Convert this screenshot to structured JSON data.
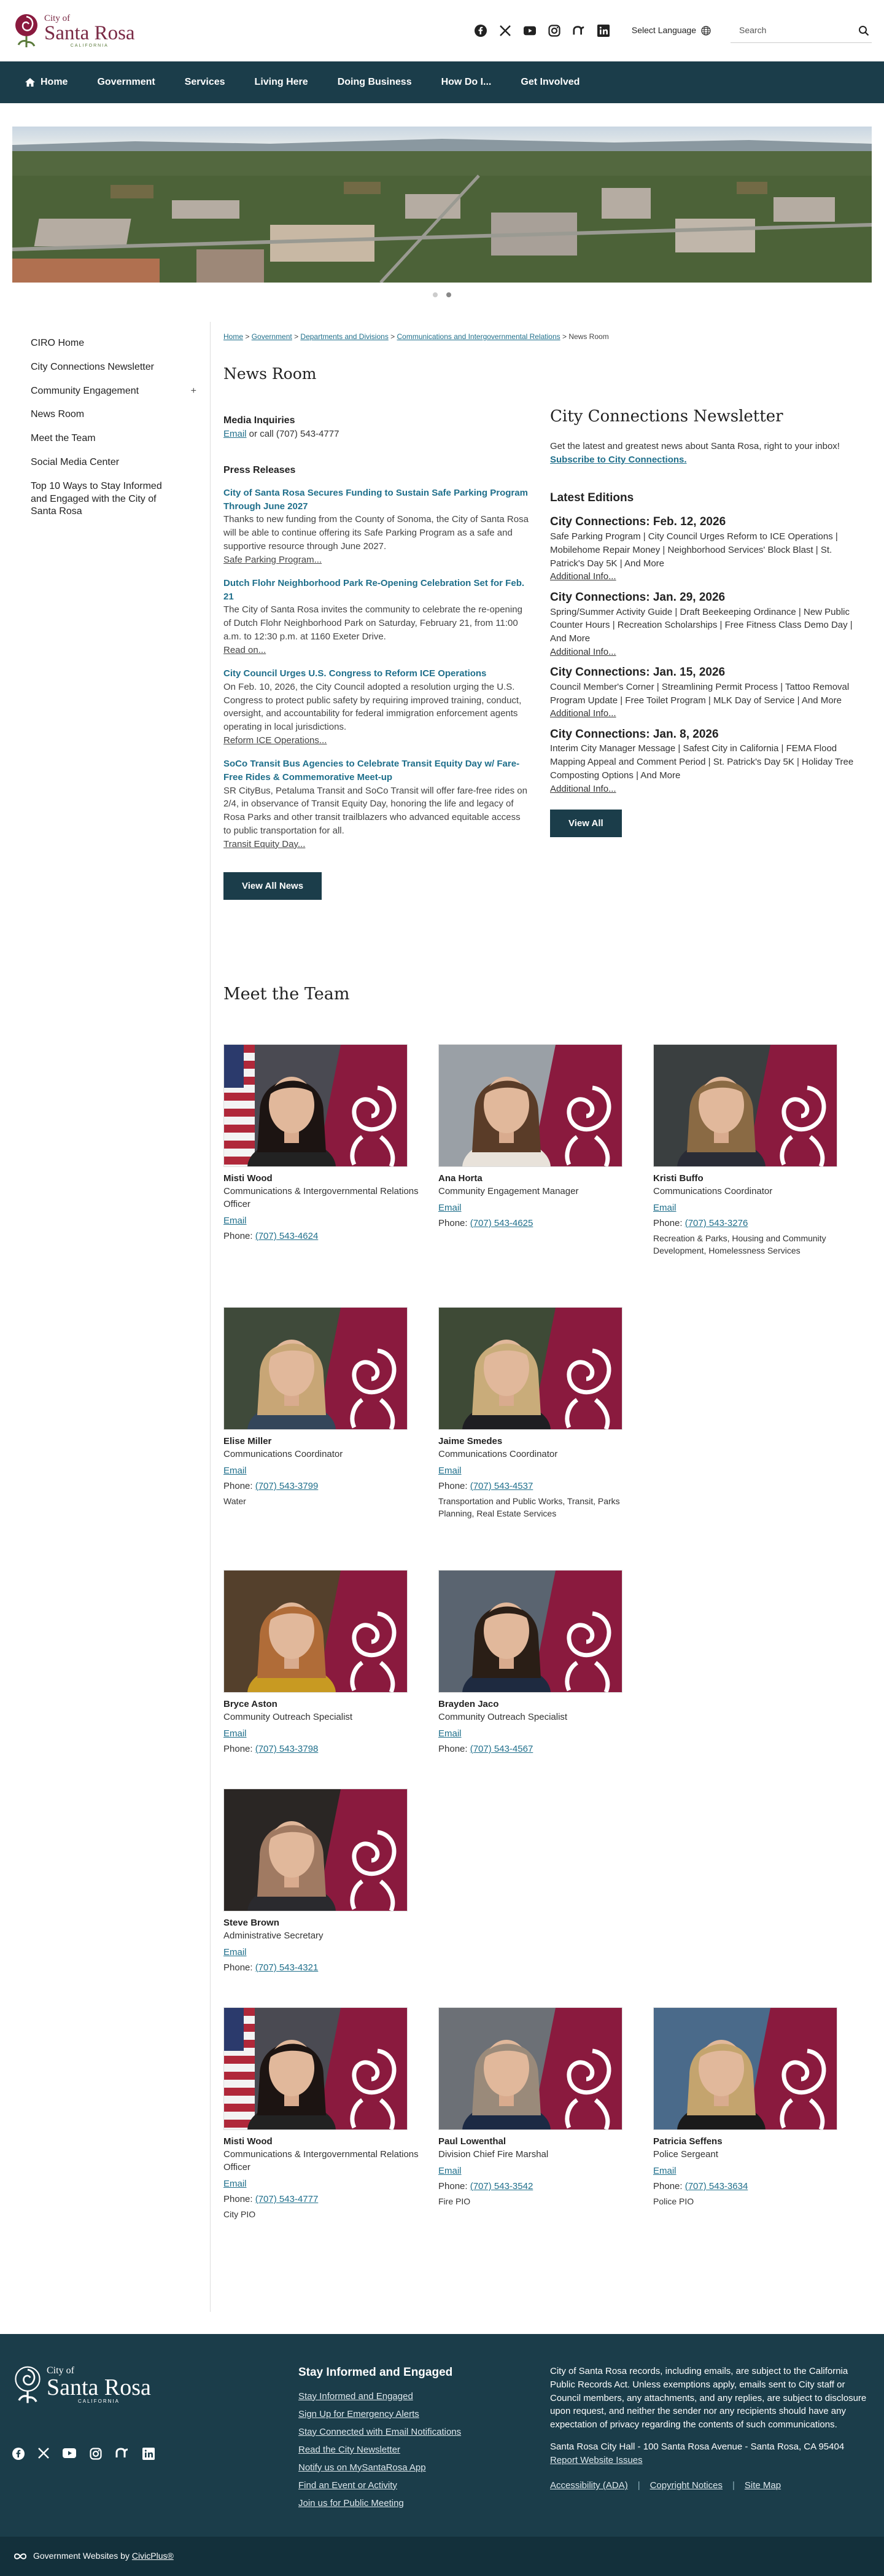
{
  "header": {
    "logo": {
      "line1": "City of",
      "line2": "Santa Rosa",
      "line3": "CALIFORNIA"
    },
    "language_label": "Select Language",
    "search_placeholder": "Search"
  },
  "nav": {
    "home": "Home",
    "items": [
      "Government",
      "Services",
      "Living Here",
      "Doing Business",
      "How Do I...",
      "Get Involved"
    ]
  },
  "sidebar": [
    {
      "label": "CIRO Home"
    },
    {
      "label": "City Connections Newsletter"
    },
    {
      "label": "Community Engagement",
      "expand": "+"
    },
    {
      "label": "News Room"
    },
    {
      "label": "Meet the Team"
    },
    {
      "label": "Social Media Center"
    },
    {
      "label": "Top 10 Ways to Stay Informed and Engaged with the City of Santa Rosa"
    }
  ],
  "breadcrumb": [
    "Home",
    "Government",
    "Departments and Divisions",
    "Communications and Intergovernmental Relations",
    "News Room"
  ],
  "page_title": "News Room",
  "media": {
    "heading": "Media Inquiries",
    "email_link": "Email",
    "text": " or call (707) 543-4777"
  },
  "press": {
    "heading": "Press Releases",
    "items": [
      {
        "title": "City of Santa Rosa Secures Funding to Sustain Safe Parking Program Through June 2027",
        "body": "Thanks to new funding from the County of Sonoma, the City of Santa Rosa will be able to continue offering its Safe Parking Program as a safe and supportive resource through June 2027.",
        "link": "Safe Parking Program..."
      },
      {
        "title": "Dutch Flohr Neighborhood Park Re-Opening Celebration Set for Feb. 21",
        "body": "The City of Santa Rosa invites the community to celebrate the re-opening of Dutch Flohr Neighborhood Park on Saturday, February 21, from 11:00 a.m. to 12:30 p.m. at 1160 Exeter Drive.",
        "link": "Read on..."
      },
      {
        "title": "City Council Urges U.S. Congress to Reform ICE Operations",
        "body": "On Feb. 10, 2026, the City Council adopted a resolution urging the U.S. Congress to protect public safety by requiring improved training, conduct, oversight, and accountability for federal immigration enforcement agents operating in local jurisdictions.",
        "link": "Reform ICE Operations..."
      },
      {
        "title": "SoCo Transit Bus Agencies to Celebrate Transit Equity Day w/ Fare-Free Rides & Commemorative Meet-up",
        "body": "SR CityBus, Petaluma Transit and SoCo Transit will offer fare-free rides on 2/4, in observance of Transit Equity Day, honoring the life and legacy of Rosa Parks and other transit trailblazers who advanced equitable access to public transportation for all.",
        "link": "Transit Equity Day..."
      }
    ],
    "button": "View All News"
  },
  "newsletter": {
    "heading": "City Connections Newsletter",
    "intro": "Get the latest and greatest news about Santa Rosa, right to your inbox! ",
    "subscribe": "Subscribe to City Connections.",
    "latest_heading": "Latest Editions",
    "editions": [
      {
        "title": "City Connections: Feb. 12, 2026",
        "body": "Safe Parking Program | City Council Urges Reform to ICE Operations | Mobilehome Repair Money | Neighborhood Services' Block Blast | St. Patrick's Day 5K | And More",
        "link": "Additional Info..."
      },
      {
        "title": "City Connections: Jan. 29, 2026",
        "body": "Spring/Summer Activity Guide | Draft Beekeeping Ordinance | New Public Counter Hours | Recreation Scholarships | Free Fitness Class Demo Day | And More",
        "link": "Additional Info..."
      },
      {
        "title": "City Connections: Jan. 15, 2026",
        "body": "Council Member's Corner | Streamlining Permit Process | Tattoo Removal Program Update | Free Toilet Program | MLK Day of Service | And More",
        "link": "Additional Info..."
      },
      {
        "title": "City Connections: Jan. 8, 2026",
        "body": "Interim City Manager Message | Safest City in California | FEMA Flood Mapping Appeal and Comment Period | St. Patrick's Day 5K | Holiday Tree Composting Options | And More",
        "link": "Additional Info..."
      }
    ],
    "button": "View All"
  },
  "team": {
    "heading": "Meet the Team",
    "members": [
      {
        "name": "Misti Wood",
        "role": "Communications & Intergovernmental Relations Officer",
        "email": "Email",
        "phone_label": "Phone: ",
        "phone": "(707) 543-4624",
        "extra": "",
        "flag": true,
        "bg": "#4a4a52",
        "hair": "#1c1412",
        "top": "#222"
      },
      {
        "name": "Ana Horta",
        "role": "Community Engagement Manager",
        "email": "Email",
        "phone_label": "Phone: ",
        "phone": "(707) 543-4625",
        "extra": "",
        "flag": false,
        "bg": "#9aa0a6",
        "hair": "#5a3c28",
        "top": "#e8e2da"
      },
      {
        "name": "Kristi Buffo",
        "role": "Communications Coordinator",
        "email": "Email",
        "phone_label": "Phone: ",
        "phone": "(707) 543-3276",
        "extra": "Recreation & Parks, Housing and Community Development, Homelessness Services",
        "flag": false,
        "bg": "#3a3f40",
        "hair": "#8a6a44",
        "top": "#2a2c36"
      },
      {
        "name": "Elise Miller",
        "role": "Communications Coordinator",
        "email": "Email",
        "phone_label": "Phone: ",
        "phone": "(707) 543-3799",
        "extra": "Water",
        "flag": false,
        "bg": "#3f4a3a",
        "hair": "#c8a676",
        "top": "#34465a"
      },
      {
        "name": "Jaime Smedes",
        "role": "Communications Coordinator",
        "email": "Email",
        "phone_label": "Phone: ",
        "phone": "(707) 543-4537",
        "extra": "Transportation and Public Works, Transit, Parks Planning, Real Estate Services",
        "flag": false,
        "bg": "#3e4a36",
        "hair": "#c9ac7a",
        "top": "#1e1e22"
      },
      {
        "name": "Bryce Aston",
        "role": "Community Outreach Specialist",
        "email": "Email",
        "phone_label": "Phone: ",
        "phone": "(707) 543-3798",
        "extra": "",
        "flag": false,
        "bg": "#54402c",
        "hair": "#b06c38",
        "top": "#c89a22"
      },
      {
        "name": "Brayden Jaco",
        "role": "Community Outreach Specialist",
        "email": "Email",
        "phone_label": "Phone: ",
        "phone": "(707) 543-4567",
        "extra": "",
        "flag": false,
        "bg": "#5a6470",
        "hair": "#2a1e16",
        "top": "#1e2a40"
      },
      {
        "name": "Steve Brown",
        "role": "Administrative Secretary",
        "email": "Email",
        "phone_label": "Phone: ",
        "phone": "(707) 543-4321",
        "extra": "",
        "flag": false,
        "bg": "#2a2624",
        "hair": "#a07a62",
        "top": "#2a2a2e"
      },
      {
        "name": "Misti Wood",
        "role": "Communications & Intergovernmental Relations Officer",
        "email": "Email",
        "phone_label": "Phone: ",
        "phone": "(707) 543-4777",
        "extra": "City PIO",
        "flag": true,
        "bg": "#4a4a52",
        "hair": "#1c1412",
        "top": "#222"
      },
      {
        "name": "Paul Lowenthal",
        "role": "Division Chief Fire Marshal",
        "email": "Email",
        "phone_label": "Phone: ",
        "phone": "(707) 543-3542",
        "extra": "Fire PIO",
        "flag": false,
        "bg": "#6c7076",
        "hair": "#9a8a7a",
        "top": "#1c2a44"
      },
      {
        "name": "Patricia Seffens",
        "role": "Police Sergeant",
        "email": "Email",
        "phone_label": "Phone: ",
        "phone": "(707) 543-3634",
        "extra": "Police PIO",
        "flag": false,
        "bg": "#4a6a8a",
        "hair": "#c4a46e",
        "top": "#1a1a1a"
      }
    ]
  },
  "footer": {
    "logo": {
      "line1": "City of",
      "line2": "Santa Rosa",
      "line3": "CALIFORNIA"
    },
    "heading": "Stay Informed and Engaged",
    "links": [
      "Stay Informed and Engaged",
      "Sign Up for Emergency Alerts",
      "Stay Connected with Email Notifications",
      "Read the City Newsletter",
      "Notify us on MySantaRosa App",
      "Find an Event or Activity",
      "Join us for Public Meeting"
    ],
    "notice": "City of Santa Rosa records, including emails, are subject to the California Public Records Act. Unless exemptions apply, emails sent to City staff or Council members, any attachments, and any replies, are subject to disclosure upon request, and neither the sender nor any recipients should have any expectation of privacy regarding the contents of such communications.",
    "address": "Santa Rosa City Hall - 100 Santa Rosa Avenue - Santa Rosa, CA 95404",
    "report": "Report Website Issues",
    "legal": [
      "Accessibility (ADA)",
      "Copyright Notices",
      "Site Map"
    ],
    "powered_prefix": "Government Websites by ",
    "powered_link": "CivicPlus®"
  },
  "colors": {
    "nav": "#1b3d4a",
    "accent": "#8a1a3e",
    "link": "#1f6f8b"
  }
}
